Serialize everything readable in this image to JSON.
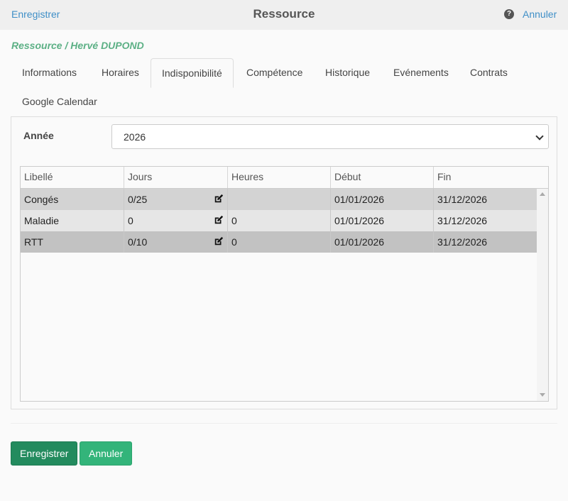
{
  "header": {
    "left_link": "Enregistrer",
    "title": "Ressource",
    "help_icon": "?",
    "right_link": "Annuler"
  },
  "breadcrumb": "Ressource / Hervé DUPOND",
  "tabs": [
    {
      "label": "Informations",
      "active": false
    },
    {
      "label": "Horaires",
      "active": false
    },
    {
      "label": "Indisponibilité",
      "active": true
    },
    {
      "label": "Compétence",
      "active": false
    },
    {
      "label": "Historique",
      "active": false
    },
    {
      "label": "Evénements",
      "active": false
    },
    {
      "label": "Contrats",
      "active": false
    },
    {
      "label": "Google Calendar",
      "active": false
    }
  ],
  "year": {
    "label": "Année",
    "value": "2026"
  },
  "table": {
    "columns": [
      "Libellé",
      "Jours",
      "Heures",
      "Début",
      "Fin"
    ],
    "rows": [
      {
        "libelle": "Congés",
        "jours": "0/25",
        "heures": "",
        "debut": "01/01/2026",
        "fin": "31/12/2026"
      },
      {
        "libelle": "Maladie",
        "jours": "0",
        "heures": "0",
        "debut": "01/01/2026",
        "fin": "31/12/2026"
      },
      {
        "libelle": "RTT",
        "jours": "0/10",
        "heures": "0",
        "debut": "01/01/2026",
        "fin": "31/12/2026"
      }
    ],
    "row_colors": [
      "#d3d3d3",
      "#e6e6e6",
      "#c2c2c2"
    ]
  },
  "buttons": {
    "save": "Enregistrer",
    "cancel": "Annuler"
  },
  "colors": {
    "link": "#3f8fc7",
    "breadcrumb": "#5cb085",
    "save_button": "#238b5e",
    "cancel_button": "#33b47a"
  }
}
